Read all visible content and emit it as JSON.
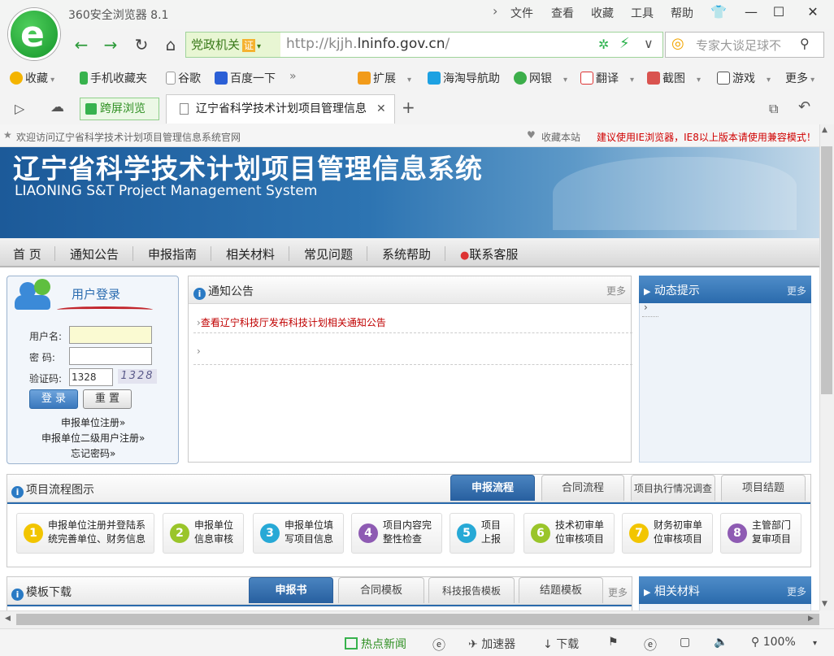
{
  "browser": {
    "title": "360安全浏览器 8.1",
    "menu": [
      "文件",
      "查看",
      "收藏",
      "工具",
      "帮助"
    ],
    "zone_label": "党政机关",
    "zone_badge": "证",
    "url_prefix": "http://kjjh.",
    "url_host": "lninfo.gov.cn",
    "url_suffix": "/",
    "search_placeholder": "专家大谈足球不",
    "bookmarks": [
      "收藏",
      "手机收藏夹",
      "谷歌",
      "百度一下",
      "扩展",
      "海淘导航助",
      "网银",
      "翻译",
      "截图",
      "游戏",
      "更多"
    ],
    "tab_green": "跨屏浏览",
    "tab_active": "辽宁省科学技术计划项目管理信息",
    "status": {
      "news": "热点新闻",
      "accelerator": "加速器",
      "download": "下载",
      "zoom": "100%"
    }
  },
  "page": {
    "welcome": "欢迎访问辽宁省科学技术计划项目管理信息系统官网",
    "bookmark_site": "收藏本站",
    "ie_notice": "建议使用IE浏览器，IE8以上版本请使用兼容模式！",
    "banner_title": "辽宁省科学技术计划项目管理信息系统",
    "banner_subtitle": "LIAONING S&T Project Management System",
    "nav": [
      "首 页",
      "通知公告",
      "申报指南",
      "相关材料",
      "常见问题",
      "系统帮助",
      "联系客服"
    ],
    "login": {
      "title": "用户登录",
      "username_label": "用户名:",
      "password_label": "密 码:",
      "captcha_label": "验证码:",
      "captcha_value": "1328",
      "captcha_image": "1328",
      "login_button": "登 录",
      "reset_button": "重 置",
      "links": [
        "申报单位注册»",
        "申报单位二级用户注册»",
        "忘记密码»"
      ]
    },
    "notice": {
      "title": "通知公告",
      "more": "更多",
      "items": [
        "查看辽宁科技厅发布科技计划相关通知公告",
        ""
      ]
    },
    "dynamic": {
      "title": "动态提示",
      "more": "更多"
    },
    "flow": {
      "title": "项目流程图示",
      "tabs": [
        "申报流程",
        "合同流程",
        "项目执行情况调查",
        "项目结题"
      ],
      "steps": [
        {
          "num": "1",
          "text": "申报单位注册并登陆系统完善单位、财务信息",
          "color": "#f2c500"
        },
        {
          "num": "2",
          "text": "申报单位信息审核",
          "color": "#9ac52a"
        },
        {
          "num": "3",
          "text": "申报单位填写项目信息",
          "color": "#27a9d6"
        },
        {
          "num": "4",
          "text": "项目内容完整性检查",
          "color": "#8e5bb3"
        },
        {
          "num": "5",
          "text": "项目上报",
          "color": "#27a9d6"
        },
        {
          "num": "6",
          "text": "技术初审单位审核项目",
          "color": "#9ac52a"
        },
        {
          "num": "7",
          "text": "财务初审单位审核项目",
          "color": "#f2c500"
        },
        {
          "num": "8",
          "text": "主管部门复审项目",
          "color": "#8e5bb3"
        }
      ]
    },
    "templates": {
      "title": "模板下载",
      "tabs": [
        "申报书",
        "合同模板",
        "科技报告模板",
        "结题模板"
      ],
      "more": "更多"
    },
    "related": {
      "title": "相关材料",
      "more": "更多"
    }
  }
}
